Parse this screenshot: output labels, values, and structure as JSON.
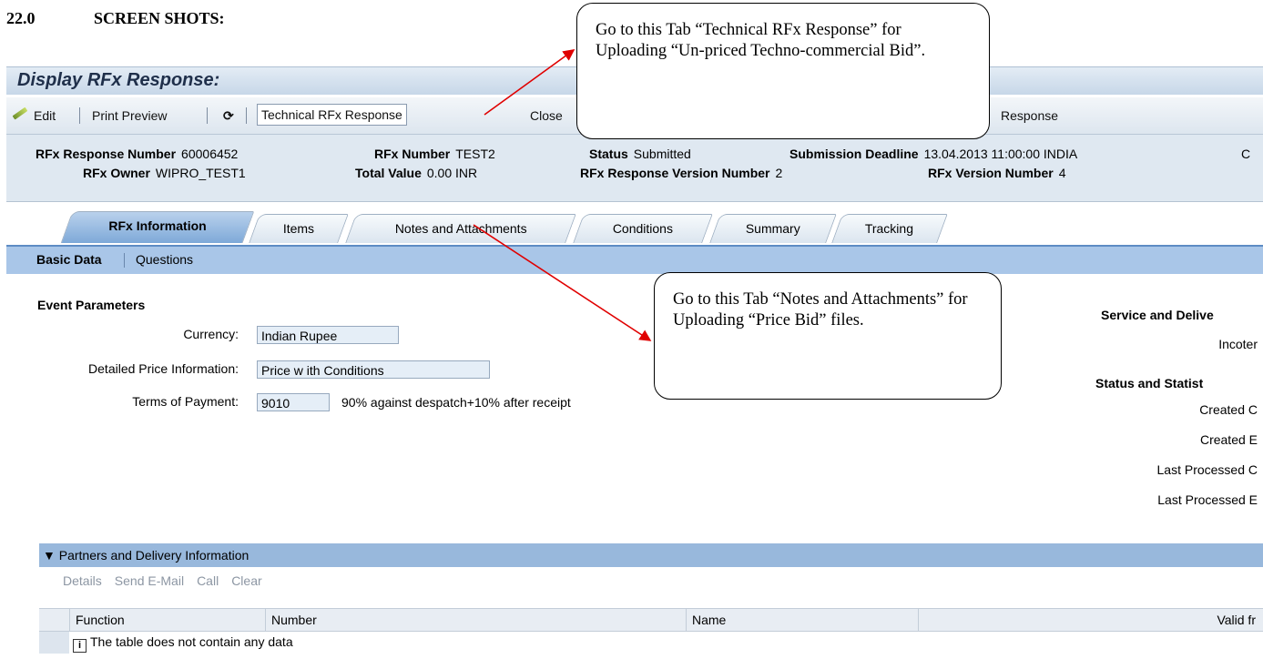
{
  "doc": {
    "section_number": "22.0",
    "section_title": "SCREEN SHOTS:"
  },
  "page_title": "Display RFx Response:",
  "toolbar": {
    "edit": "Edit",
    "print_preview": "Print Preview",
    "technical": "Technical RFx Response",
    "close": "Close",
    "response": "Response"
  },
  "header": {
    "rfx_response_number_label": "RFx Response Number",
    "rfx_response_number": "60006452",
    "rfx_number_label": "RFx Number",
    "rfx_number": "TEST2",
    "status_label": "Status",
    "status": "Submitted",
    "submission_deadline_label": "Submission Deadline",
    "submission_deadline": "13.04.2013 11:00:00 INDIA",
    "trailing": "C",
    "rfx_owner_label": "RFx Owner",
    "rfx_owner": "WIPRO_TEST1",
    "total_value_label": "Total Value",
    "total_value": "0.00 INR",
    "response_version_label": "RFx Response Version Number",
    "response_version": "2",
    "rfx_version_label": "RFx Version Number",
    "rfx_version": "4"
  },
  "tabs": [
    "RFx Information",
    "Items",
    "Notes and Attachments",
    "Conditions",
    "Summary",
    "Tracking"
  ],
  "subtabs": [
    "Basic Data",
    "Questions"
  ],
  "event_parameters": {
    "title": "Event Parameters",
    "currency_label": "Currency:",
    "currency": "Indian Rupee",
    "price_info_label": "Detailed Price Information:",
    "price_info": "Price w ith Conditions",
    "payment_label": "Terms of Payment:",
    "payment_code": "9010",
    "payment_text": "90% against despatch+10% after receipt"
  },
  "right_panel": {
    "service_title": "Service and Delive",
    "incoterms": "Incoter",
    "status_title": "Status and Statist",
    "created_on": "Created C",
    "created_by": "Created E",
    "last_processed_on": "Last Processed C",
    "last_processed_by": "Last Processed E"
  },
  "partners": {
    "title": "Partners and Delivery Information",
    "tools": [
      "Details",
      "Send E-Mail",
      "Call",
      "Clear"
    ],
    "columns": [
      "Function",
      "Number",
      "Name",
      "Valid fr"
    ],
    "empty_text": "The table does not contain any data"
  },
  "callouts": {
    "technical": "Go to this Tab “Technical RFx Response” for Uploading “Un-priced Techno-commercial Bid”.",
    "notes": "Go to this Tab “Notes and Attachments” for Uploading “Price Bid” files."
  }
}
